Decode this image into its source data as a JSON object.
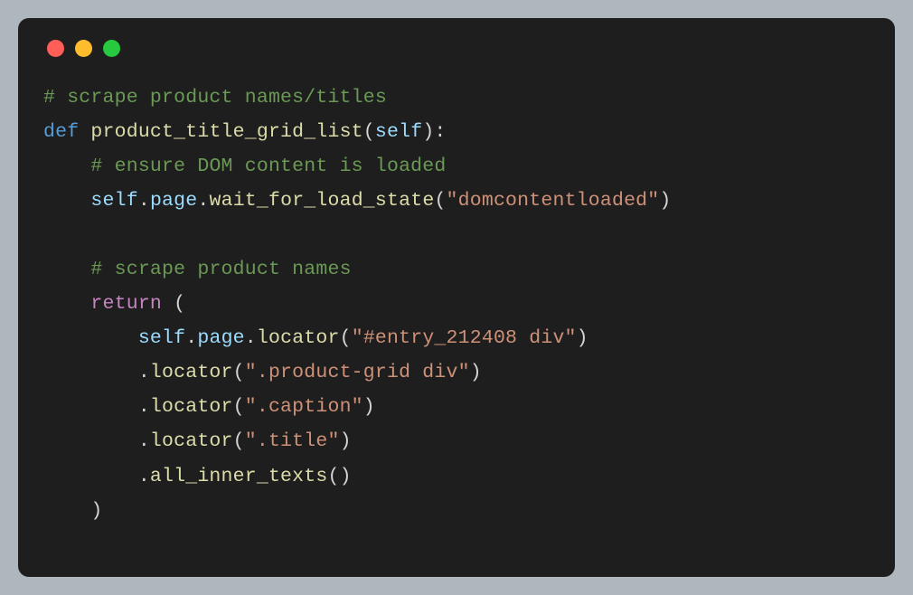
{
  "code": {
    "line1_comment": "# scrape product names/titles",
    "line2_def": "def",
    "line2_fn": "product_title_grid_list",
    "line2_open": "(",
    "line2_self": "self",
    "line2_close": "):",
    "line3_indent": "    ",
    "line3_comment": "# ensure DOM content is loaded",
    "line4_indent": "    ",
    "line4_self": "self",
    "line4_dot1": ".",
    "line4_page": "page",
    "line4_dot2": ".",
    "line4_wait": "wait_for_load_state",
    "line4_open": "(",
    "line4_str": "\"domcontentloaded\"",
    "line4_close": ")",
    "line6_indent": "    ",
    "line6_comment": "# scrape product names",
    "line7_indent": "    ",
    "line7_return": "return",
    "line7_paren": " (",
    "line8_indent": "        ",
    "line8_self": "self",
    "line8_dot1": ".",
    "line8_page": "page",
    "line8_dot2": ".",
    "line8_locator": "locator",
    "line8_open": "(",
    "line8_str": "\"#entry_212408 div\"",
    "line8_close": ")",
    "line9_indent": "        .",
    "line9_locator": "locator",
    "line9_open": "(",
    "line9_str": "\".product-grid div\"",
    "line9_close": ")",
    "line10_indent": "        .",
    "line10_locator": "locator",
    "line10_open": "(",
    "line10_str": "\".caption\"",
    "line10_close": ")",
    "line11_indent": "        .",
    "line11_locator": "locator",
    "line11_open": "(",
    "line11_str": "\".title\"",
    "line11_close": ")",
    "line12_indent": "        .",
    "line12_fn": "all_inner_texts",
    "line12_paren": "()",
    "line13_indent": "    ",
    "line13_close": ")"
  }
}
